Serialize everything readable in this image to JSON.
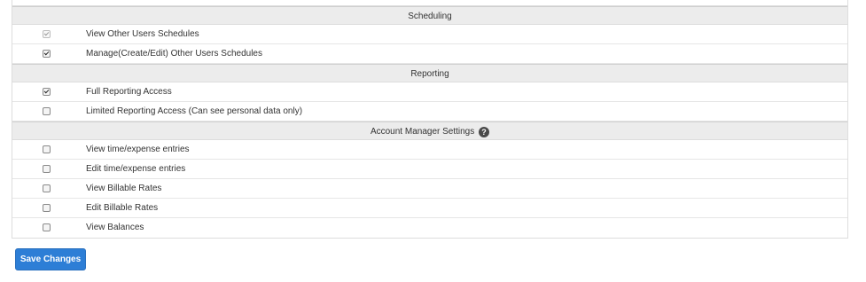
{
  "sections": {
    "scheduling": {
      "title": "Scheduling",
      "items": [
        {
          "label": "View Other Users Schedules",
          "checked": true,
          "disabled": true
        },
        {
          "label": "Manage(Create/Edit) Other Users Schedules",
          "checked": true,
          "disabled": false
        }
      ]
    },
    "reporting": {
      "title": "Reporting",
      "items": [
        {
          "label": "Full Reporting Access",
          "checked": true,
          "disabled": false
        },
        {
          "label": "Limited Reporting Access (Can see personal data only)",
          "checked": false,
          "disabled": false
        }
      ]
    },
    "account_manager": {
      "title": "Account Manager Settings",
      "help_icon": "question-circle-icon",
      "help_glyph": "?",
      "items": [
        {
          "label": "View time/expense entries",
          "checked": false,
          "disabled": false
        },
        {
          "label": "Edit time/expense entries",
          "checked": false,
          "disabled": false
        },
        {
          "label": "View Billable Rates",
          "checked": false,
          "disabled": false
        },
        {
          "label": "Edit Billable Rates",
          "checked": false,
          "disabled": false
        },
        {
          "label": "View Balances",
          "checked": false,
          "disabled": false
        }
      ]
    }
  },
  "actions": {
    "save_label": "Save Changes",
    "save_color": "#2d7ed6"
  }
}
